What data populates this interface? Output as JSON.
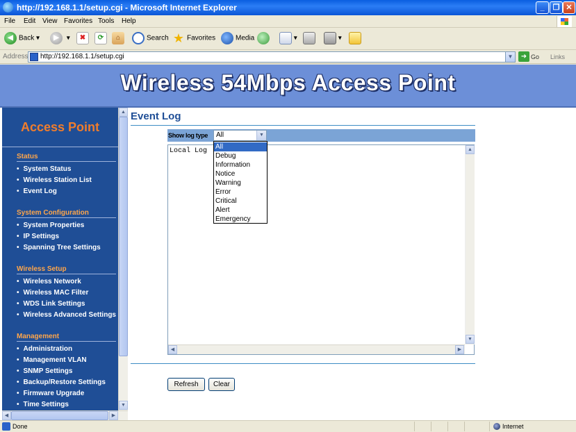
{
  "window": {
    "title": "http://192.168.1.1/setup.cgi - Microsoft Internet Explorer"
  },
  "menu": [
    "File",
    "Edit",
    "View",
    "Favorites",
    "Tools",
    "Help"
  ],
  "toolbar": {
    "back": "Back",
    "search": "Search",
    "favorites": "Favorites",
    "media": "Media"
  },
  "address": {
    "label": "Address",
    "url": "http://192.168.1.1/setup.cgi",
    "go": "Go",
    "links": "Links"
  },
  "banner": {
    "title": "Wireless 54Mbps Access Point"
  },
  "sidebar": {
    "brand": "Access Point",
    "sections": [
      {
        "title": "Status",
        "items": [
          "System Status",
          "Wireless Station List",
          "Event Log"
        ]
      },
      {
        "title": "System Configuration",
        "items": [
          "System Properties",
          "IP Settings",
          "Spanning Tree Settings"
        ]
      },
      {
        "title": "Wireless Setup",
        "items": [
          "Wireless Network",
          "Wireless MAC Filter",
          "WDS Link Settings",
          "Wireless Advanced Settings"
        ]
      },
      {
        "title": "Management",
        "items": [
          "Administration",
          "Management VLAN",
          "SNMP Settings",
          "Backup/Restore Settings",
          "Firmware Upgrade",
          "Time Settings"
        ]
      }
    ]
  },
  "main": {
    "page_title": "Event Log",
    "log_type_label": "Show log type",
    "log_type_value": "All",
    "log_type_options": [
      "All",
      "Debug",
      "Information",
      "Notice",
      "Warning",
      "Error",
      "Critical",
      "Alert",
      "Emergency"
    ],
    "log_text": "Local Log",
    "refresh_button": "Refresh",
    "clear_button": "Clear"
  },
  "status": {
    "text": "Done",
    "zone": "Internet"
  },
  "colors": {
    "nav_bg": "#1f4e96",
    "brand": "#f07d2c",
    "section": "#ffa64a",
    "banner": "#6c8fd8",
    "accent": "#3c8cc4"
  },
  "icons": [
    "ie-icon",
    "back-icon",
    "forward-icon",
    "stop-icon",
    "refresh-icon",
    "home-icon",
    "search-icon",
    "favorites-star-icon",
    "media-icon",
    "history-icon",
    "mail-icon",
    "print-icon",
    "edit-icon",
    "folder-icon",
    "go-arrow-icon",
    "windows-flag-icon",
    "globe-icon"
  ]
}
